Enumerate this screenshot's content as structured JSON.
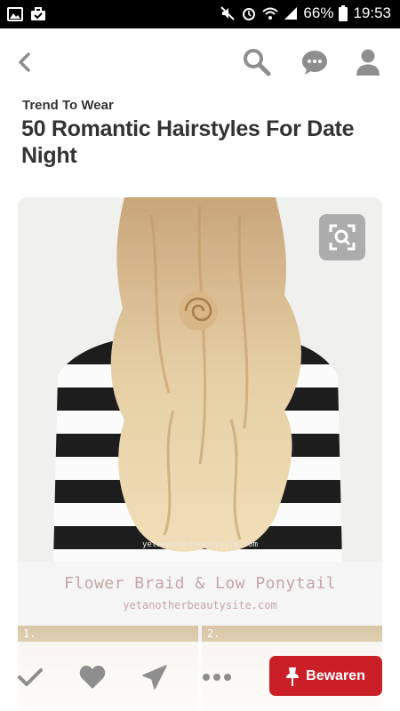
{
  "status_bar": {
    "battery_percent": "66%",
    "time": "19:53",
    "icons": [
      "image-icon",
      "briefcase-icon",
      "mute-icon",
      "alarm-icon",
      "wifi-icon",
      "signal-icon",
      "battery-icon"
    ]
  },
  "nav": {
    "icons": [
      "back-arrow-icon",
      "search-icon",
      "messages-icon",
      "profile-icon"
    ]
  },
  "article": {
    "kicker": "Trend To Wear",
    "title": "50 Romantic Hairstyles For Date Night"
  },
  "pin": {
    "caption_title": "Flower Braid & Low Ponytail",
    "caption_url": "yetanotherbeautysite.com",
    "watermark": "yetanotherbeautysite.com",
    "thumb_numbers": [
      "1.",
      "2."
    ],
    "lens_icon": "visual-search-icon"
  },
  "actions": {
    "icons": [
      "checkmark-icon",
      "heart-icon",
      "send-icon",
      "more-icon"
    ],
    "save_label": "Bewaren",
    "save_icon": "pin-icon",
    "save_color": "#cb1f27"
  }
}
